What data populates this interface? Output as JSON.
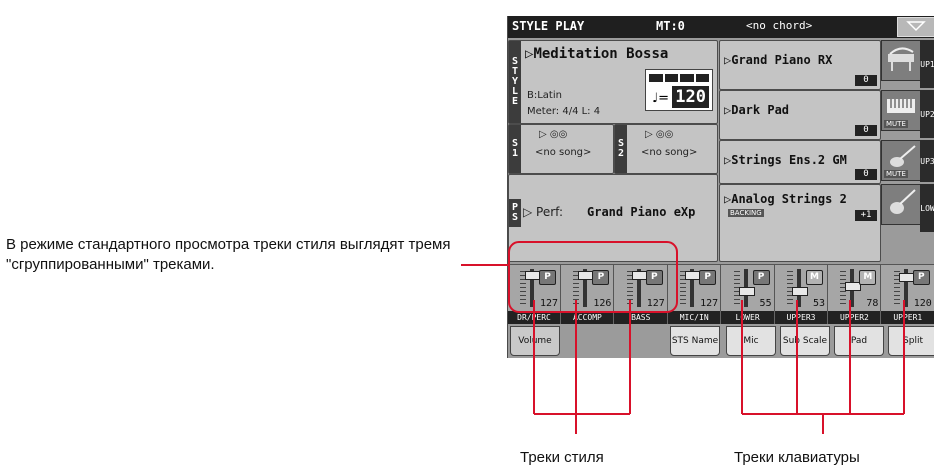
{
  "annotations": {
    "main": "В режиме стандартного просмотра треки стиля выглядят тремя \"сгруппированными\" треками.",
    "style_tracks": "Треки стиля",
    "keyboard_tracks": "Треки клавиатуры"
  },
  "screen": {
    "title": "STYLE PLAY",
    "mt": "MT:0",
    "chord": "<no chord>",
    "style": {
      "tag": "STYLE",
      "name": "Meditation Bossa",
      "bank": "B:Latin",
      "meter": "Meter: 4/4  L: 4",
      "tempo": "120",
      "tempo_note": "♩="
    },
    "song1": {
      "tag": "S1",
      "text": "<no song>"
    },
    "song2": {
      "tag": "S2",
      "text": "<no song>"
    },
    "perf": {
      "tag": "PS",
      "label": "Perf:",
      "name": "Grand Piano eXp"
    },
    "sounds": [
      {
        "name": "Grand Piano RX",
        "octave": "0",
        "side": "UP1",
        "icon": "piano-icon",
        "sub": ""
      },
      {
        "name": "Dark Pad",
        "octave": "0",
        "side": "UP2",
        "icon": "keyboard-icon",
        "sub": ""
      },
      {
        "name": "Strings Ens.2 GM",
        "octave": "0",
        "side": "UP3",
        "icon": "violin-icon",
        "sub": ""
      },
      {
        "name": "Analog Strings 2",
        "octave": "+1",
        "side": "LOW",
        "icon": "violin-icon",
        "sub": "BACKING"
      }
    ],
    "mute_label": "MUTE",
    "channels": [
      {
        "name": "DR/PERC",
        "value": "127",
        "level": 1.0,
        "pm": "P"
      },
      {
        "name": "ACCOMP",
        "value": "126",
        "level": 0.99,
        "pm": "P"
      },
      {
        "name": "BASS",
        "value": "127",
        "level": 1.0,
        "pm": "P"
      },
      {
        "name": "MIC/IN",
        "value": "127",
        "level": 1.0,
        "pm": "P"
      },
      {
        "name": "LOWER",
        "value": "55",
        "level": 0.43,
        "pm": "P"
      },
      {
        "name": "UPPER3",
        "value": "53",
        "level": 0.42,
        "pm": "M"
      },
      {
        "name": "UPPER2",
        "value": "78",
        "level": 0.61,
        "pm": "M"
      },
      {
        "name": "UPPER1",
        "value": "120",
        "level": 0.94,
        "pm": "P"
      }
    ],
    "tabs": [
      {
        "label": "Volume"
      },
      {
        "label": ""
      },
      {
        "label": "STS Name"
      },
      {
        "label": "Mic"
      },
      {
        "label": "Sub Scale"
      },
      {
        "label": "Pad"
      },
      {
        "label": "Split"
      }
    ]
  }
}
